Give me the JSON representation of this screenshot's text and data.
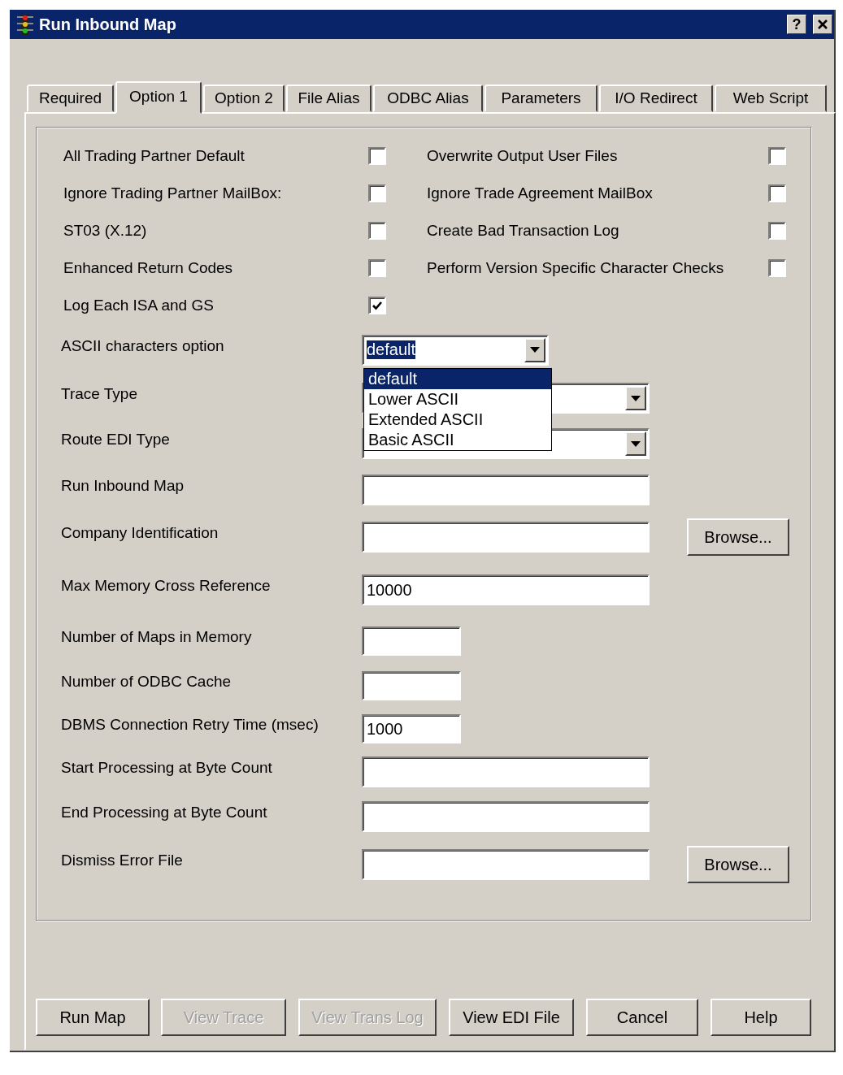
{
  "window": {
    "title": "Run Inbound Map",
    "help": "?"
  },
  "tabs": [
    {
      "label": "Required",
      "selected": false
    },
    {
      "label": "Option 1",
      "selected": true
    },
    {
      "label": "Option 2",
      "selected": false
    },
    {
      "label": "File Alias",
      "selected": false
    },
    {
      "label": "ODBC Alias",
      "selected": false
    },
    {
      "label": "Parameters",
      "selected": false
    },
    {
      "label": "I/O Redirect",
      "selected": false
    },
    {
      "label": "Web Script",
      "selected": false
    }
  ],
  "checkbox_rows": [
    [
      {
        "label": "All Trading Partner Default",
        "checked": false
      },
      {
        "label": "Overwrite Output User Files",
        "checked": false
      }
    ],
    [
      {
        "label": "Ignore Trading Partner MailBox:",
        "checked": false
      },
      {
        "label": "Ignore Trade Agreement MailBox",
        "checked": false
      }
    ],
    [
      {
        "label": "ST03 (X.12)",
        "checked": false
      },
      {
        "label": "Create Bad Transaction Log",
        "checked": false
      }
    ],
    [
      {
        "label": "Enhanced Return Codes",
        "checked": false
      },
      {
        "label": "Perform Version Specific Character Checks",
        "checked": false
      }
    ],
    [
      {
        "label": "Log Each ISA and GS",
        "checked": true
      }
    ]
  ],
  "fields": [
    {
      "kind": "combo",
      "label": "ASCII characters option",
      "value": "default",
      "options": [
        {
          "label": "default",
          "selected": true
        },
        {
          "label": "Lower ASCII",
          "selected": false
        },
        {
          "label": "Extended ASCII",
          "selected": false
        },
        {
          "label": "Basic ASCII",
          "selected": false
        }
      ]
    },
    {
      "kind": "wide_combo",
      "label": "Trace Type"
    },
    {
      "kind": "wide_combo",
      "label": "Route EDI Type"
    },
    {
      "kind": "text",
      "label": "Run Inbound Map"
    },
    {
      "kind": "text",
      "label": "Company Identification",
      "browse": "Browse..."
    },
    {
      "kind": "text",
      "label": "Max Memory Cross Reference",
      "value": "10000"
    },
    {
      "kind": "short_text",
      "label": "Number of Maps in Memory"
    },
    {
      "kind": "short_text",
      "label": "Number of ODBC Cache"
    },
    {
      "kind": "short_text",
      "label": "DBMS Connection Retry Time (msec)",
      "value": "1000"
    },
    {
      "kind": "text",
      "label": "Start Processing at Byte Count"
    },
    {
      "kind": "text",
      "label": "End Processing at Byte Count"
    },
    {
      "kind": "text",
      "label": "Dismiss Error File",
      "browse": "Browse..."
    }
  ],
  "buttons": [
    {
      "label": "Run Map",
      "disabled": false
    },
    {
      "label": "View Trace",
      "disabled": true
    },
    {
      "label": "View Trans Log",
      "disabled": true
    },
    {
      "label": "View EDI File",
      "disabled": false
    },
    {
      "label": "Cancel",
      "disabled": false
    },
    {
      "label": "Help",
      "disabled": false
    }
  ]
}
